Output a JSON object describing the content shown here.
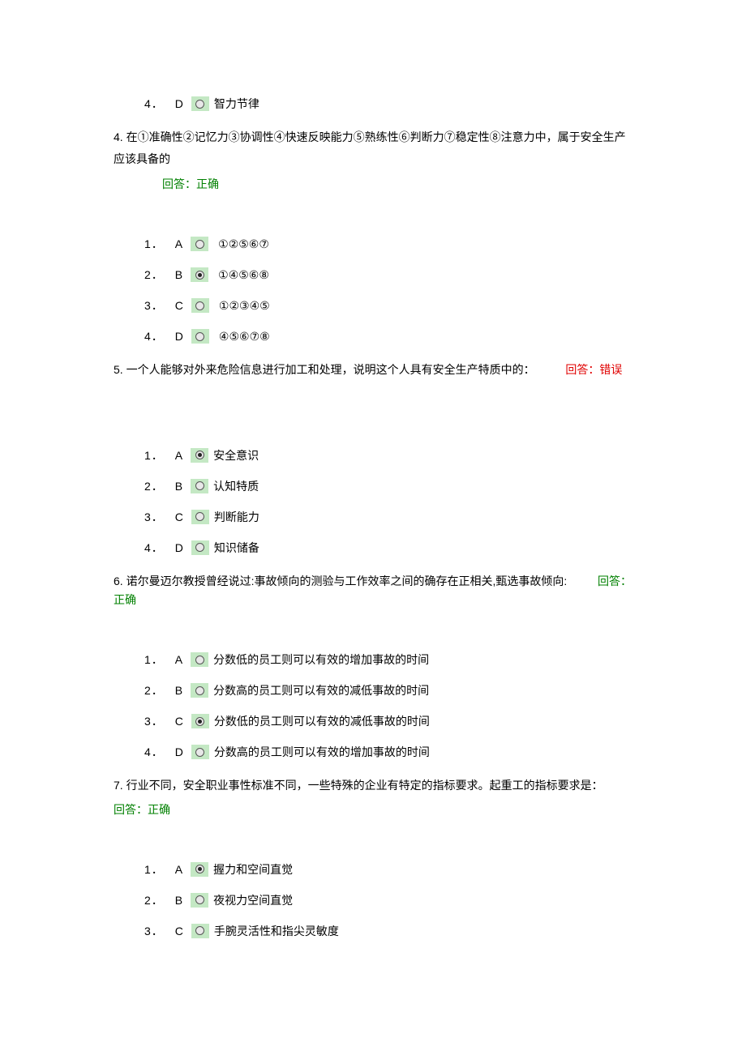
{
  "q3_tail": {
    "opt4": {
      "num": "4．",
      "letter": "D",
      "text": "智力节律"
    }
  },
  "q4": {
    "prompt": "4. 在①准确性②记忆力③协调性④快速反映能力⑤熟练性⑥判断力⑦稳定性⑧注意力中，属于安全生产应该具备的",
    "feedback": "回答：正确",
    "options": [
      {
        "num": "1．",
        "letter": "A",
        "text": "①②⑤⑥⑦"
      },
      {
        "num": "2．",
        "letter": "B",
        "text": "①④⑤⑥⑧"
      },
      {
        "num": "3．",
        "letter": "C",
        "text": "①②③④⑤"
      },
      {
        "num": "4．",
        "letter": "D",
        "text": "④⑤⑥⑦⑧"
      }
    ],
    "selected": 1
  },
  "q5": {
    "prompt": "5. 一个人能够对外来危险信息进行加工和处理，说明这个人具有安全生产特质中的：",
    "feedback": "回答：错误",
    "options": [
      {
        "num": "1．",
        "letter": "A",
        "text": "安全意识"
      },
      {
        "num": "2．",
        "letter": "B",
        "text": "认知特质"
      },
      {
        "num": "3．",
        "letter": "C",
        "text": "判断能力"
      },
      {
        "num": "4．",
        "letter": "D",
        "text": "知识储备"
      }
    ],
    "selected": 0
  },
  "q6": {
    "prompt": "6. 诺尔曼迈尔教授曾经说过:事故倾向的测验与工作效率之间的确存在正相关,甄选事故倾向:",
    "feedback_front": "回答：",
    "feedback_word": "正确",
    "options": [
      {
        "num": "1．",
        "letter": "A",
        "text": "分数低的员工则可以有效的增加事故的时间"
      },
      {
        "num": "2．",
        "letter": "B",
        "text": "分数高的员工则可以有效的减低事故的时间"
      },
      {
        "num": "3．",
        "letter": "C",
        "text": "分数低的员工则可以有效的减低事故的时间"
      },
      {
        "num": "4．",
        "letter": "D",
        "text": "分数高的员工则可以有效的增加事故的时间"
      }
    ],
    "selected": 2
  },
  "q7": {
    "prompt": "7. 行业不同，安全职业事性标准不同，一些特殊的企业有特定的指标要求。起重工的指标要求是：",
    "feedback": "回答：正确",
    "options": [
      {
        "num": "1．",
        "letter": "A",
        "text": "握力和空间直觉"
      },
      {
        "num": "2．",
        "letter": "B",
        "text": "夜视力空间直觉"
      },
      {
        "num": "3．",
        "letter": "C",
        "text": "手腕灵活性和指尖灵敏度"
      }
    ],
    "selected": 0
  }
}
